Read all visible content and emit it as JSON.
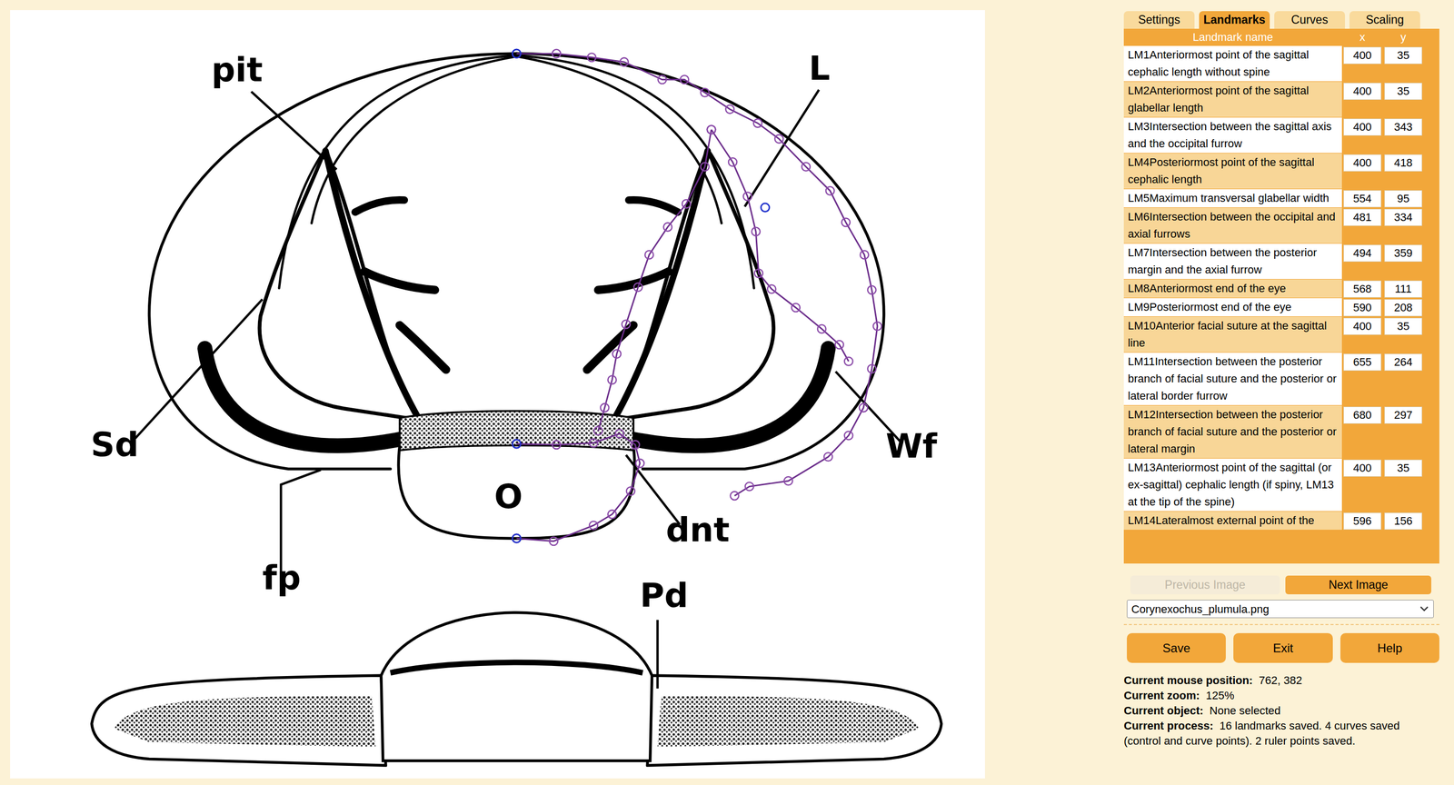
{
  "tabs": [
    {
      "label": "Settings",
      "selected": false
    },
    {
      "label": "Landmarks",
      "selected": true
    },
    {
      "label": "Curves",
      "selected": false
    },
    {
      "label": "Scaling",
      "selected": false
    }
  ],
  "table": {
    "columns": [
      "Landmark name",
      "x",
      "y"
    ],
    "rows": [
      {
        "name": "LM1Anteriormost point of the sagittal cephalic length without spine",
        "x": "400",
        "y": "35"
      },
      {
        "name": "LM2Anteriormost point of the sagittal glabellar length",
        "x": "400",
        "y": "35"
      },
      {
        "name": "LM3Intersection between the sagittal axis and the occipital furrow",
        "x": "400",
        "y": "343"
      },
      {
        "name": "LM4Posteriormost point of the sagittal cephalic length",
        "x": "400",
        "y": "418"
      },
      {
        "name": "LM5Maximum transversal glabellar width",
        "x": "554",
        "y": "95"
      },
      {
        "name": "LM6Intersection between the occipital and axial furrows",
        "x": "481",
        "y": "334"
      },
      {
        "name": "LM7Intersection between the posterior margin and the axial furrow",
        "x": "494",
        "y": "359"
      },
      {
        "name": "LM8Anteriormost end of the eye",
        "x": "568",
        "y": "111"
      },
      {
        "name": "LM9Posteriormost end of the eye",
        "x": "590",
        "y": "208"
      },
      {
        "name": "LM10Anterior facial suture at the sagittal line",
        "x": "400",
        "y": "35"
      },
      {
        "name": "LM11Intersection between the posterior branch of facial suture and the posterior or lateral border furrow",
        "x": "655",
        "y": "264"
      },
      {
        "name": "LM12Intersection between the posterior branch of facial suture and the posterior or lateral margin",
        "x": "680",
        "y": "297"
      },
      {
        "name": "LM13Anteriormost point of the sagittal (or ex-sagittal) cephalic length (if spiny, LM13 at the tip of the spine)",
        "x": "400",
        "y": "35"
      },
      {
        "name": "LM14Lateralmost external point of the",
        "x": "596",
        "y": "156"
      }
    ]
  },
  "nav": {
    "previous": {
      "label": "Previous Image",
      "disabled": true
    },
    "next": {
      "label": "Next Image",
      "disabled": false
    }
  },
  "file_select": {
    "value": "Corynexochus_plumula.png"
  },
  "actions": [
    "Save",
    "Exit",
    "Help"
  ],
  "status": [
    {
      "label": "Current mouse position:",
      "value": "762, 382"
    },
    {
      "label": "Current zoom:",
      "value": "125%"
    },
    {
      "label": "Current object:",
      "value": "None selected"
    },
    {
      "label": "Current process:",
      "value": "16 landmarks saved. 4 curves saved (control and curve points). 2 ruler points saved."
    }
  ],
  "figure": {
    "labels": [
      "pit",
      "L",
      "Sd",
      "Wf",
      "dnt",
      "O",
      "fp",
      "Pd"
    ]
  }
}
